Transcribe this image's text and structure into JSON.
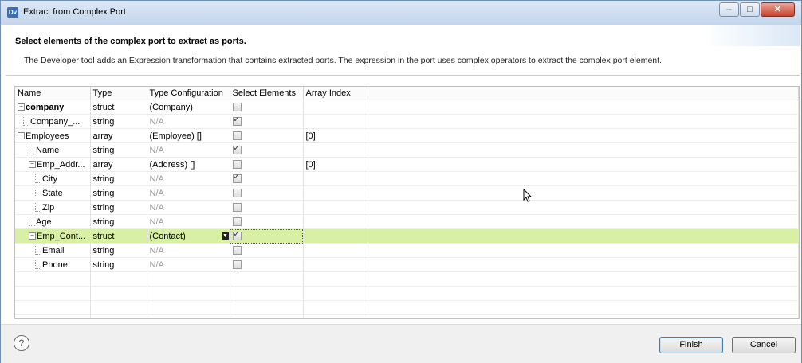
{
  "window": {
    "title": "Extract from Complex Port",
    "app_icon": "Dv"
  },
  "header": {
    "heading": "Select elements of the complex port to extract as ports.",
    "description": "The Developer tool adds an Expression transformation that contains extracted ports. The expression in the port uses complex operators to extract the complex port element."
  },
  "grid": {
    "columns": {
      "name": "Name",
      "type": "Type",
      "config": "Type Configuration",
      "select": "Select Elements",
      "index": "Array Index"
    },
    "rows": [
      {
        "name": "company",
        "type": "struct",
        "config": "(Company)",
        "selected": false,
        "index": ""
      },
      {
        "name": "Company_...",
        "type": "string",
        "config": "N/A",
        "selected": true,
        "index": ""
      },
      {
        "name": "Employees",
        "type": "array",
        "config": "(Employee) []",
        "selected": false,
        "index": "[0]"
      },
      {
        "name": "Name",
        "type": "string",
        "config": "N/A",
        "selected": true,
        "index": ""
      },
      {
        "name": "Emp_Addr...",
        "type": "array",
        "config": "(Address) []",
        "selected": false,
        "index": "[0]"
      },
      {
        "name": "City",
        "type": "string",
        "config": "N/A",
        "selected": true,
        "index": ""
      },
      {
        "name": "State",
        "type": "string",
        "config": "N/A",
        "selected": false,
        "index": ""
      },
      {
        "name": "Zip",
        "type": "string",
        "config": "N/A",
        "selected": false,
        "index": ""
      },
      {
        "name": "Age",
        "type": "string",
        "config": "N/A",
        "selected": false,
        "index": ""
      },
      {
        "name": "Emp_Cont...",
        "type": "struct",
        "config": "(Contact)",
        "selected": true,
        "index": ""
      },
      {
        "name": "Email",
        "type": "string",
        "config": "N/A",
        "selected": false,
        "index": ""
      },
      {
        "name": "Phone",
        "type": "string",
        "config": "N/A",
        "selected": false,
        "index": ""
      }
    ]
  },
  "buttons": {
    "finish": "Finish",
    "cancel": "Cancel",
    "help": "?"
  },
  "colors": {
    "selected_row": "#d8f0a4",
    "titlebar": "#c4d6ec"
  }
}
